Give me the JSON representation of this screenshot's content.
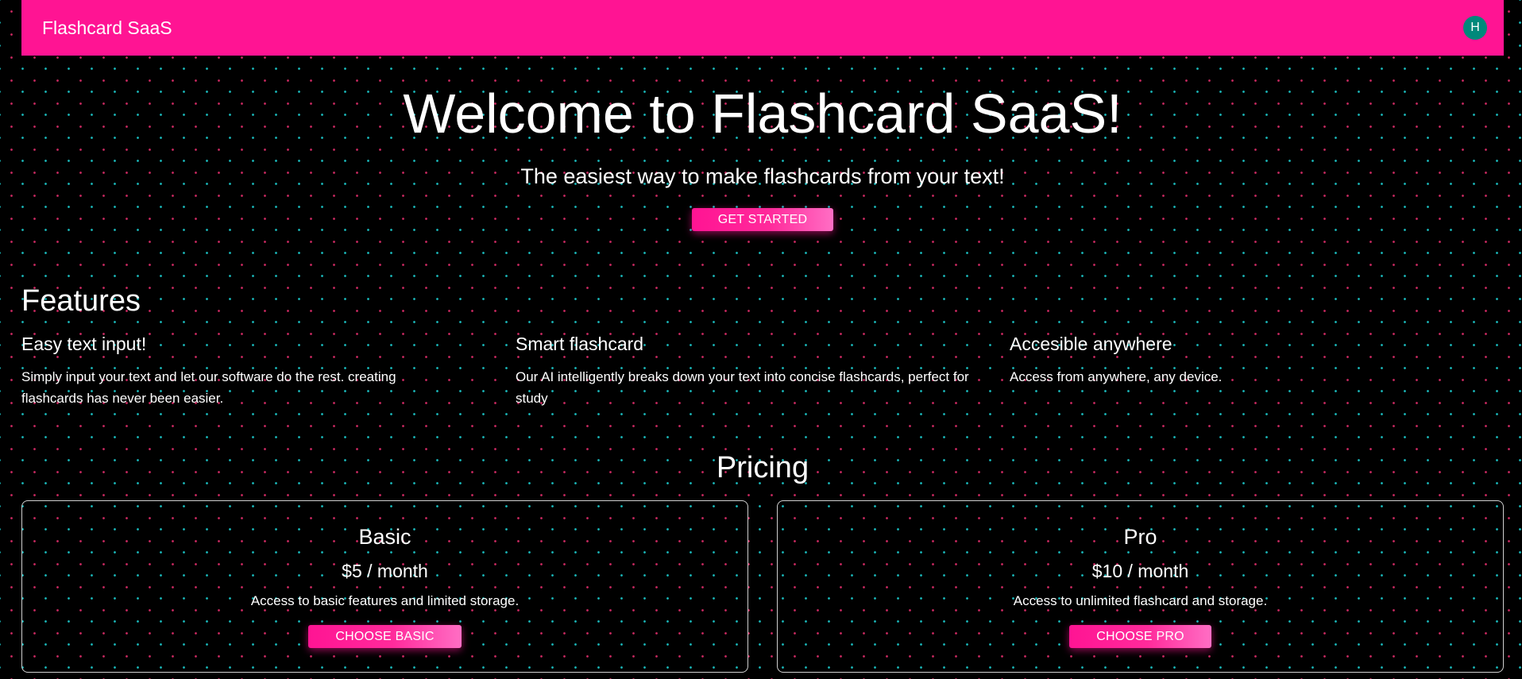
{
  "appbar": {
    "title": "Flashcard SaaS",
    "avatar_initial": "H",
    "color": "#ff1493",
    "avatar_color": "#00897b"
  },
  "hero": {
    "title": "Welcome to Flashcard SaaS!",
    "subtitle": "The easiest way to make flashcards from your text!",
    "cta_label": "Get Started"
  },
  "features": {
    "title": "Features",
    "items": [
      {
        "title": "Easy text input!",
        "description": "Simply input your text and let our software do the rest. creating flashcards has never been easier."
      },
      {
        "title": "Smart flashcard",
        "description": "Our AI intelligently breaks down your text into concise flashcards, perfect for study"
      },
      {
        "title": "Accesible anywhere",
        "description": "Access from anywhere, any device."
      }
    ]
  },
  "pricing": {
    "title": "Pricing",
    "plans": [
      {
        "name": "Basic",
        "price": "$5 / month",
        "description": "Access to basic features and limited storage.",
        "button_label": "Choose Basic"
      },
      {
        "name": "Pro",
        "price": "$10 / month",
        "description": "Access to unlimited flashcard and storage.",
        "button_label": "Choose Pro"
      }
    ]
  },
  "colors": {
    "background": "#000000",
    "accent": "#ff1493",
    "dot_pink": "#c7285f",
    "dot_teal": "#19b6b8",
    "card_border": "#cfcfcf"
  }
}
